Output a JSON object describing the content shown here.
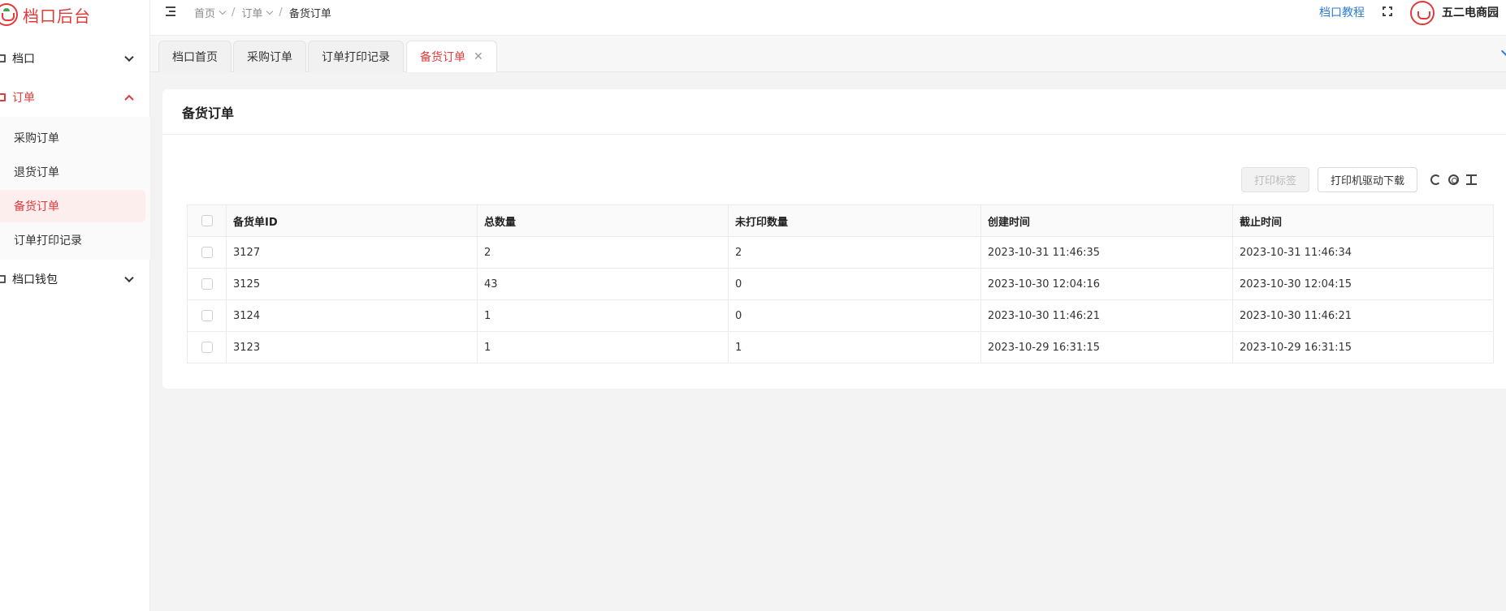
{
  "app": {
    "title": "档口后台",
    "brand_color": "#e23a3a"
  },
  "sidebar": {
    "groups": [
      {
        "label": "档口",
        "expanded": false,
        "icon": "monitor-icon"
      },
      {
        "label": "订单",
        "expanded": true,
        "icon": "monitor-icon",
        "items": [
          {
            "label": "采购订单"
          },
          {
            "label": "退货订单"
          },
          {
            "label": "备货订单",
            "active": true
          },
          {
            "label": "订单打印记录"
          }
        ]
      },
      {
        "label": "档口钱包",
        "expanded": false,
        "icon": "monitor-icon"
      }
    ]
  },
  "header": {
    "breadcrumb": [
      "首页",
      "订单",
      "备货订单"
    ],
    "help_link": "档口教程",
    "user_name": "五二电商园",
    "link_color": "#2d7bd8"
  },
  "tabs": [
    {
      "label": "档口首页"
    },
    {
      "label": "采购订单"
    },
    {
      "label": "订单打印记录"
    },
    {
      "label": "备货订单",
      "active": true,
      "closable": true
    }
  ],
  "page": {
    "title": "备货订单",
    "toolbar": {
      "print_label": "打印标签",
      "driver_download": "打印机驱动下载"
    },
    "table": {
      "columns": [
        "备货单ID",
        "总数量",
        "未打印数量",
        "创建时间",
        "截止时间"
      ],
      "rows": [
        [
          "3127",
          "2",
          "2",
          "2023-10-31 11:46:35",
          "2023-10-31 11:46:34"
        ],
        [
          "3125",
          "43",
          "0",
          "2023-10-30 12:04:16",
          "2023-10-30 12:04:15"
        ],
        [
          "3124",
          "1",
          "0",
          "2023-10-30 11:46:21",
          "2023-10-30 11:46:21"
        ],
        [
          "3123",
          "1",
          "1",
          "2023-10-29 16:31:15",
          "2023-10-29 16:31:15"
        ]
      ]
    }
  }
}
